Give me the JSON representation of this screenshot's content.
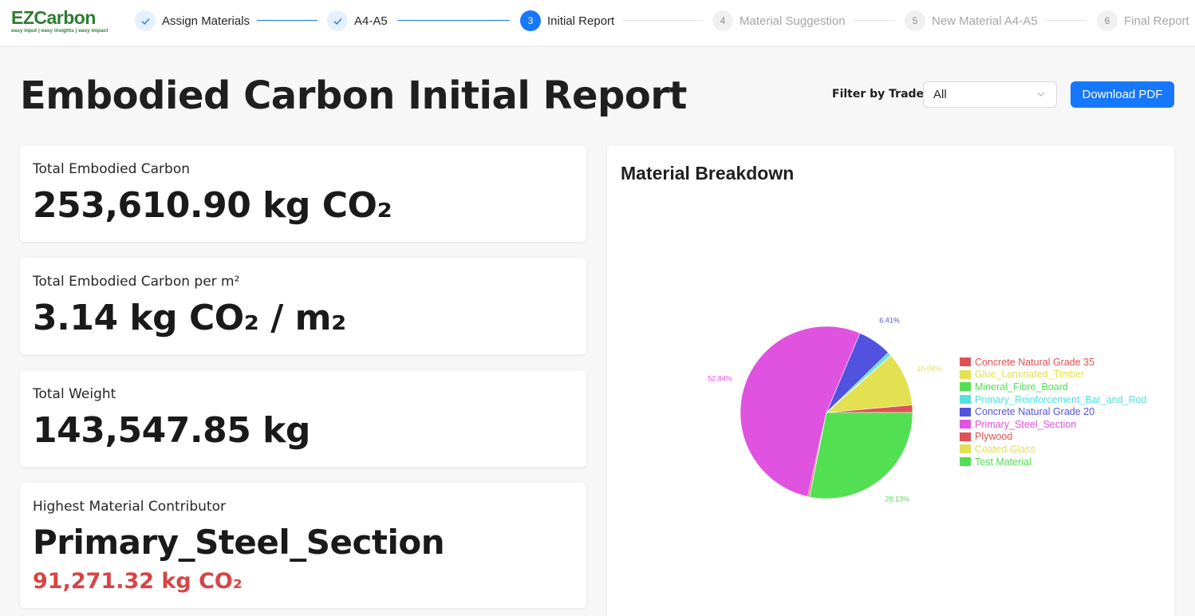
{
  "logo": {
    "name": "EZCarbon",
    "tagline": "easy input | easy insights | easy impact"
  },
  "steps": [
    {
      "number": "1",
      "label": "Assign Materials",
      "status": "done"
    },
    {
      "number": "2",
      "label": "A4-A5",
      "status": "done"
    },
    {
      "number": "3",
      "label": "Initial Report",
      "status": "active"
    },
    {
      "number": "4",
      "label": "Material Suggestion",
      "status": "wait"
    },
    {
      "number": "5",
      "label": "New Material A4-A5",
      "status": "wait"
    },
    {
      "number": "6",
      "label": "Final Report",
      "status": "wait"
    }
  ],
  "header": {
    "title": "Embodied Carbon Initial Report",
    "filter_label": "Filter by Trade:",
    "filter_value": "All",
    "download_label": "Download PDF"
  },
  "cards": {
    "total_carbon": {
      "label": "Total Embodied Carbon",
      "value": "253,610.90 kg CO₂"
    },
    "per_m2": {
      "label": "Total Embodied Carbon per m²",
      "value": "3.14 kg CO₂ / m₂"
    },
    "weight": {
      "label": "Total Weight",
      "value": "143,547.85 kg"
    },
    "highest": {
      "label": "Highest Material Contributor",
      "value": "Primary_Steel_Section",
      "sub": "91,271.32 kg CO₂"
    }
  },
  "colors": {
    "accent": "#1677ff",
    "brand": "#2e7d32",
    "highlight_red": "#d64545"
  },
  "chart_data": {
    "type": "pie",
    "title": "Material Breakdown",
    "legend_position": "right",
    "slices": [
      {
        "name": "Concrete Natural Grade 35",
        "value": 1.4,
        "label": "",
        "color": "#e05252"
      },
      {
        "name": "Glue_Laminated_Timber",
        "value": 10.04,
        "label": "10.04%",
        "color": "#e3e052"
      },
      {
        "name": "Mineral_Fibre_Board",
        "value": 0.2,
        "label": "",
        "color": "#52e052"
      },
      {
        "name": "Primary_Reinforcement_Bar_and_Rod",
        "value": 0.6,
        "label": "",
        "color": "#52e0e0"
      },
      {
        "name": "Concrete Natural Grade 20",
        "value": 6.41,
        "label": "6.41%",
        "color": "#5252e0"
      },
      {
        "name": "Primary_Steel_Section",
        "value": 52.84,
        "label": "52.84%",
        "color": "#e052e0"
      },
      {
        "name": "Plywood",
        "value": 0.3,
        "label": "",
        "color": "#e05252"
      },
      {
        "name": "Coated Glass",
        "value": 0.05,
        "label": "",
        "color": "#e3e052"
      },
      {
        "name": "Test Material",
        "value": 28.13,
        "label": "28.13%",
        "color": "#52e052"
      }
    ]
  }
}
